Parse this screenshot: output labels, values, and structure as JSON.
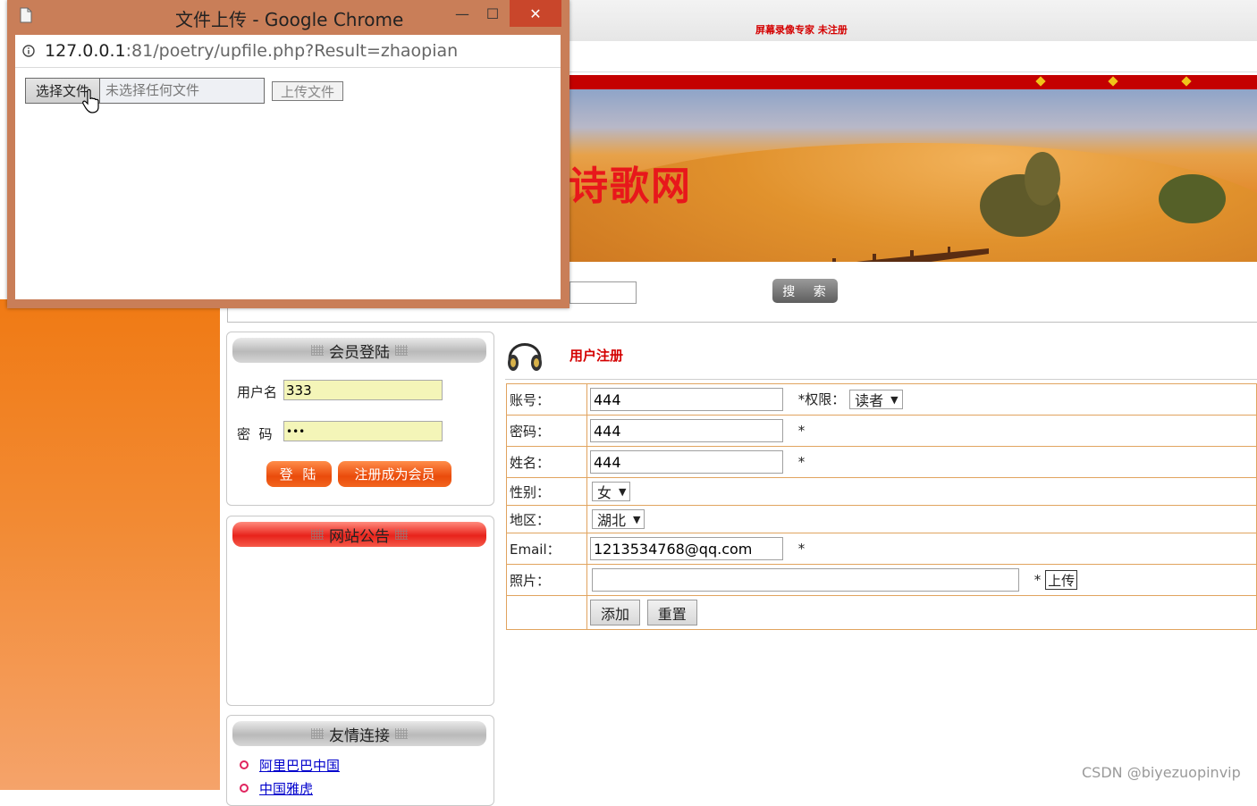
{
  "recorder": {
    "text": "屏幕录像专家  未注册"
  },
  "banner": {
    "title": "诗歌网"
  },
  "search": {
    "button_label": "搜 索"
  },
  "login_panel": {
    "title": "会员登陆",
    "username_label": "用户名",
    "username_value": "333",
    "password_label": "密  码",
    "password_value": "•••",
    "login_button": "登  陆",
    "register_button": "注册成为会员"
  },
  "notice_panel": {
    "title": "网站公告"
  },
  "links_panel": {
    "title": "友情连接",
    "items": [
      "阿里巴巴中国",
      "中国雅虎"
    ]
  },
  "registration": {
    "title": "用户注册",
    "account_label": "账号：",
    "account_value": "444",
    "role_label": "*权限：",
    "role_value": "读者",
    "password_label": "密码：",
    "password_value": "444",
    "name_label": "姓名：",
    "name_value": "444",
    "gender_label": "性别：",
    "gender_value": "女",
    "region_label": "地区：",
    "region_value": "湖北",
    "email_label": "Email：",
    "email_value": "1213534768@qq.com",
    "photo_label": "照片：",
    "photo_value": "",
    "upload_label": "上传",
    "required_mark": "*",
    "add_button": "添加",
    "reset_button": "重置"
  },
  "popup": {
    "window_title": "文件上传 - Google Chrome",
    "url_host": "127.0.0.1",
    "url_rest": ":81/poetry/upfile.php?Result=zhaopian",
    "choose_button": "选择文件",
    "no_file_text": "未选择任何文件",
    "upload_button": "上传文件",
    "minimize": "—",
    "maximize": "☐",
    "close": "✕"
  },
  "watermark": "CSDN @biyezuopinvip",
  "colors": {
    "accent_red": "#d40000",
    "orange": "#f07a14",
    "table_border": "#e1a45f",
    "popup_frame": "#c97e58"
  }
}
